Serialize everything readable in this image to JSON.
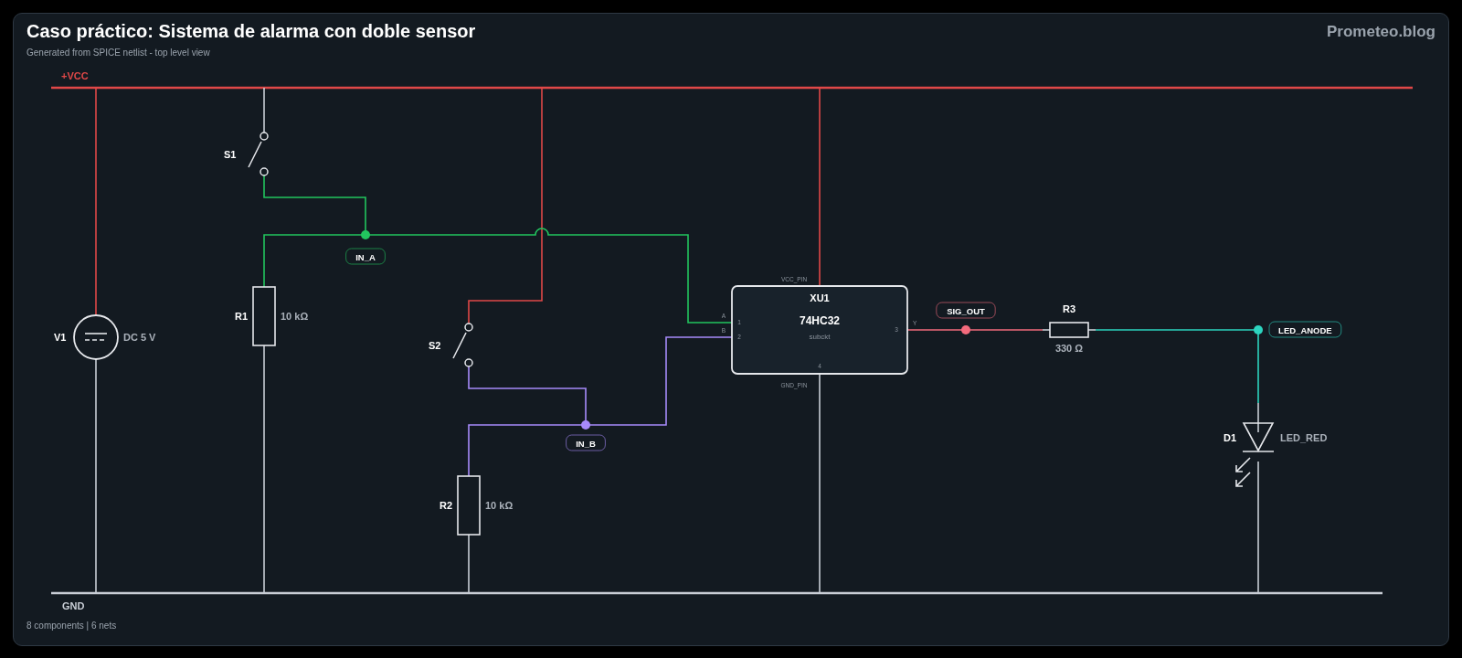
{
  "header": {
    "title": "Caso práctico: Sistema de alarma con doble sensor",
    "subtitle": "Generated from SPICE netlist - top level view",
    "brand": "Prometeo.blog"
  },
  "nets": [
    {
      "name": "+VCC",
      "color": "#e04848",
      "kind": "rail"
    },
    {
      "name": "GND",
      "color": "#c9ced6",
      "kind": "rail"
    },
    {
      "name": "IN_A",
      "color": "#22c55e",
      "kind": "label"
    },
    {
      "name": "IN_B",
      "color": "#a78bfa",
      "kind": "label"
    },
    {
      "name": "SIG_OUT",
      "color": "#f46b7d",
      "kind": "label"
    },
    {
      "name": "LED_ANODE",
      "color": "#2dd4bf",
      "kind": "label"
    }
  ],
  "components": [
    {
      "ref": "V1",
      "kind": "source",
      "value": "DC 5 V"
    },
    {
      "ref": "S1",
      "kind": "switch"
    },
    {
      "ref": "R1",
      "kind": "resistor",
      "value": "10 kΩ"
    },
    {
      "ref": "S2",
      "kind": "switch"
    },
    {
      "ref": "R2",
      "kind": "resistor",
      "value": "10 kΩ"
    },
    {
      "ref": "XU1",
      "kind": "ic",
      "value": "74HC32",
      "model": "subckt",
      "power_pin": "VCC_PIN",
      "ground_pin": "GND_PIN",
      "pins": [
        {
          "number": "1",
          "name": "A"
        },
        {
          "number": "2",
          "name": "B"
        },
        {
          "number": "3",
          "name": "Y"
        },
        {
          "number": "4"
        }
      ]
    },
    {
      "ref": "R3",
      "kind": "resistor",
      "value": "330 Ω"
    },
    {
      "ref": "D1",
      "kind": "led",
      "value": "LED_RED"
    }
  ],
  "footer": "8 components | 6 nets"
}
